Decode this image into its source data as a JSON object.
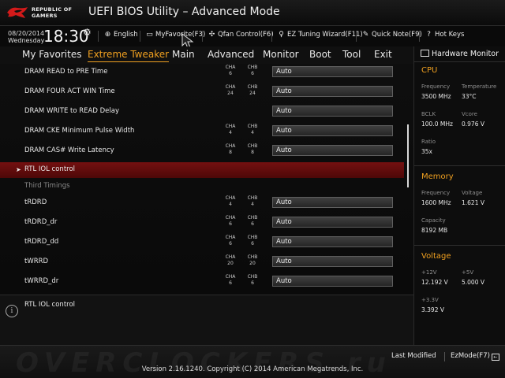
{
  "header": {
    "logo_text_line1": "REPUBLIC OF",
    "logo_text_line2": "GAMERS",
    "title": "UEFI BIOS Utility – Advanced Mode"
  },
  "infobar": {
    "date": "08/20/2014",
    "weekday": "Wednesday",
    "time": "18:30",
    "tools": [
      {
        "label": "English",
        "icon": "globe-icon"
      },
      {
        "label": "MyFavorite(F3)",
        "icon": "favorites-icon"
      },
      {
        "label": "Qfan Control(F6)",
        "icon": "fan-icon"
      },
      {
        "label": "EZ Tuning Wizard(F11)",
        "icon": "bulb-icon"
      },
      {
        "label": "Quick Note(F9)",
        "icon": "note-icon"
      },
      {
        "label": "Hot Keys",
        "icon": "question-icon"
      }
    ]
  },
  "tabs": [
    {
      "label": "My Favorites"
    },
    {
      "label": "Extreme Tweaker",
      "active": true
    },
    {
      "label": "Main"
    },
    {
      "label": "Advanced"
    },
    {
      "label": "Monitor"
    },
    {
      "label": "Boot"
    },
    {
      "label": "Tool"
    },
    {
      "label": "Exit"
    }
  ],
  "channel_labels": {
    "a": "CHA",
    "b": "CHB"
  },
  "settings": [
    {
      "label": "DRAM READ to PRE Time",
      "cha": "6",
      "chb": "6",
      "value": "Auto"
    },
    {
      "label": "DRAM FOUR ACT WIN Time",
      "cha": "24",
      "chb": "24",
      "value": "Auto"
    },
    {
      "label": "DRAM WRITE to READ Delay",
      "value": "Auto"
    },
    {
      "label": "DRAM CKE Minimum Pulse Width",
      "cha": "4",
      "chb": "4",
      "value": "Auto"
    },
    {
      "label": "DRAM CAS# Write Latency",
      "cha": "8",
      "chb": "8",
      "value": "Auto"
    },
    {
      "label": "RTL IOL control",
      "selected": true
    },
    {
      "label": "Third Timings",
      "heading": true
    },
    {
      "label": "tRDRD",
      "cha": "4",
      "chb": "4",
      "value": "Auto"
    },
    {
      "label": "tRDRD_dr",
      "cha": "6",
      "chb": "6",
      "value": "Auto"
    },
    {
      "label": "tRDRD_dd",
      "cha": "6",
      "chb": "6",
      "value": "Auto"
    },
    {
      "label": "tWRRD",
      "cha": "20",
      "chb": "20",
      "value": "Auto"
    },
    {
      "label": "tWRRD_dr",
      "cha": "6",
      "chb": "6",
      "value": "Auto"
    }
  ],
  "help": {
    "text": "RTL IOL control"
  },
  "hardware_monitor": {
    "title": "Hardware Monitor",
    "cpu": {
      "section": "CPU",
      "frequency_label": "Frequency",
      "frequency": "3500 MHz",
      "temperature_label": "Temperature",
      "temperature": "33°C",
      "bclk_label": "BCLK",
      "bclk": "100.0 MHz",
      "vcore_label": "Vcore",
      "vcore": "0.976 V",
      "ratio_label": "Ratio",
      "ratio": "35x"
    },
    "memory": {
      "section": "Memory",
      "frequency_label": "Frequency",
      "frequency": "1600 MHz",
      "voltage_label": "Voltage",
      "voltage": "1.621 V",
      "capacity_label": "Capacity",
      "capacity": "8192 MB"
    },
    "voltage": {
      "section": "Voltage",
      "v12_label": "+12V",
      "v12": "12.192 V",
      "v5_label": "+5V",
      "v5": "5.000 V",
      "v33_label": "+3.3V",
      "v33": "3.392 V"
    }
  },
  "footer": {
    "watermark": "OVERCLOCKERS.ru",
    "last_modified": "Last Modified",
    "ez_mode": "EzMode(F7)",
    "version": "Version 2.16.1240. Copyright (C) 2014 American Megatrends, Inc."
  },
  "colors": {
    "accent": "#f0a020",
    "selected_row": "#6a0e0e"
  }
}
